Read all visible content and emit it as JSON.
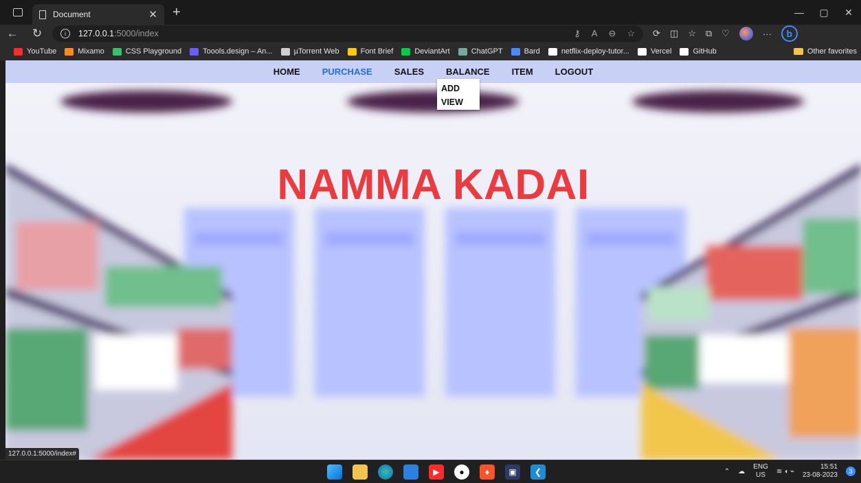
{
  "browser": {
    "tab_title": "Document",
    "url_host": "127.0.0.1",
    "url_path": ":5000/index",
    "status_url": "127.0.0.1:5000/index#"
  },
  "bookmarks": [
    {
      "label": "YouTube",
      "color": "#ff2a2a"
    },
    {
      "label": "Mixamo",
      "color": "#ff8a1a"
    },
    {
      "label": "CSS Playground",
      "color": "#36c26b"
    },
    {
      "label": "Toools.design – An...",
      "color": "#6a5cff"
    },
    {
      "label": "µTorrent Web",
      "color": "#d0d0d0"
    },
    {
      "label": "Font Brief",
      "color": "#ffcc00"
    },
    {
      "label": "DeviantArt",
      "color": "#05cc47"
    },
    {
      "label": "ChatGPT",
      "color": "#74aa9c"
    },
    {
      "label": "Bard",
      "color": "#4b8bff"
    },
    {
      "label": "netflix-deploy-tutor...",
      "color": "#ffffff"
    },
    {
      "label": "Vercel",
      "color": "#ffffff"
    },
    {
      "label": "GitHub",
      "color": "#ffffff"
    }
  ],
  "other_favorites": "Other favorites",
  "nav": {
    "items": [
      "HOME",
      "PURCHASE",
      "SALES",
      "BALANCE",
      "ITEM",
      "LOGOUT"
    ],
    "active": "PURCHASE",
    "dropdown": [
      "ADD",
      "VIEW"
    ]
  },
  "hero_title": "NAMMA KADAI",
  "taskbar": {
    "lang_top": "ENG",
    "lang_bottom": "US",
    "time": "15:51",
    "date": "23-08-2023",
    "notifications": "3"
  },
  "colors": {
    "accent": "#1c6fe6",
    "hero": "#ec3b3f",
    "navbar": "#c9d0f5"
  }
}
